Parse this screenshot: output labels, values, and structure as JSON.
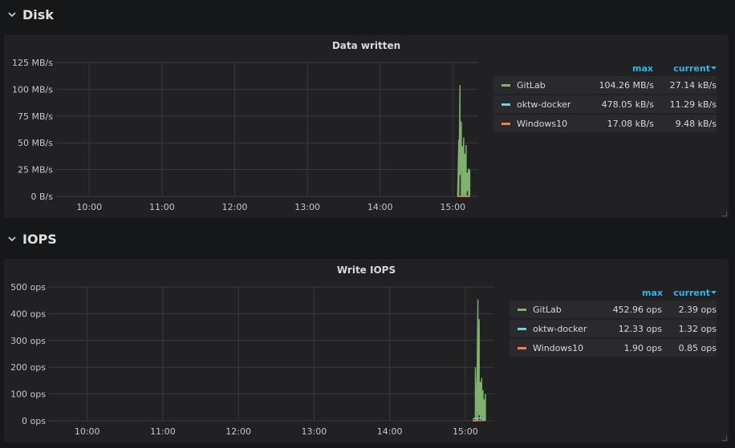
{
  "rows": [
    {
      "title": "Disk"
    },
    {
      "title": "IOPS"
    }
  ],
  "icons": {
    "row_collapse": "chevron-down-icon",
    "sort": "caret-down-icon"
  },
  "colors": {
    "GitLab": "#7eb26d",
    "oktw-docker": "#6ed0e0",
    "Windows10": "#ef843c",
    "legend_header": "#33b5e5"
  },
  "panels": [
    {
      "title": "Data written",
      "legend": {
        "header_max": "max",
        "header_current": "current",
        "items": [
          {
            "name": "GitLab",
            "max": "104.26 MB/s",
            "current": "27.14 kB/s"
          },
          {
            "name": "oktw-docker",
            "max": "478.05 kB/s",
            "current": "11.29 kB/s"
          },
          {
            "name": "Windows10",
            "max": "17.08 kB/s",
            "current": "9.48 kB/s"
          }
        ]
      }
    },
    {
      "title": "Write IOPS",
      "legend": {
        "header_max": "max",
        "header_current": "current",
        "items": [
          {
            "name": "GitLab",
            "max": "452.96 ops",
            "current": "2.39 ops"
          },
          {
            "name": "oktw-docker",
            "max": "12.33 ops",
            "current": "1.32 ops"
          },
          {
            "name": "Windows10",
            "max": "1.90 ops",
            "current": "0.85 ops"
          }
        ]
      }
    }
  ],
  "chart_data": [
    {
      "type": "line",
      "title": "Data written",
      "xlabel": "",
      "ylabel": "",
      "xlim": [
        "09:32",
        "15:21"
      ],
      "x_ticks": [
        "10:00",
        "11:00",
        "12:00",
        "13:00",
        "14:00",
        "15:00"
      ],
      "y_ticks": [
        "0 B/s",
        "25 MB/s",
        "50 MB/s",
        "75 MB/s",
        "100 MB/s",
        "125 MB/s"
      ],
      "ylim": [
        0,
        125
      ],
      "y_unit": "MB/s",
      "grid": true,
      "legend_position": "right",
      "series": [
        {
          "name": "GitLab",
          "x": [
            "15:04",
            "15:05",
            "15:05",
            "15:06",
            "15:06",
            "15:07",
            "15:07",
            "15:08",
            "15:08",
            "15:09",
            "15:09",
            "15:10",
            "15:10",
            "15:11",
            "15:11",
            "15:12",
            "15:12",
            "15:13",
            "15:13",
            "15:14",
            "15:14"
          ],
          "values": [
            0,
            53,
            0,
            104,
            20,
            70,
            0,
            47,
            0,
            55,
            0,
            40,
            0,
            48,
            0,
            22,
            5,
            26,
            0,
            25,
            0
          ]
        },
        {
          "name": "oktw-docker",
          "x": [
            "15:04",
            "15:14"
          ],
          "values": [
            0,
            0
          ]
        },
        {
          "name": "Windows10",
          "x": [
            "15:04",
            "15:14"
          ],
          "values": [
            0,
            0
          ]
        }
      ]
    },
    {
      "type": "line",
      "title": "Write IOPS",
      "xlabel": "",
      "ylabel": "",
      "xlim": [
        "09:29",
        "15:23"
      ],
      "x_ticks": [
        "10:00",
        "11:00",
        "12:00",
        "13:00",
        "14:00",
        "15:00"
      ],
      "y_ticks": [
        "0 ops",
        "100 ops",
        "200 ops",
        "300 ops",
        "400 ops",
        "500 ops"
      ],
      "ylim": [
        0,
        500
      ],
      "y_unit": "ops",
      "grid": true,
      "legend_position": "right",
      "series": [
        {
          "name": "GitLab",
          "x": [
            "15:06",
            "15:08",
            "15:08",
            "15:09",
            "15:10",
            "15:10",
            "15:11",
            "15:11",
            "15:12",
            "15:12",
            "15:13",
            "15:13",
            "15:14",
            "15:14",
            "15:15",
            "15:15",
            "15:16",
            "15:16"
          ],
          "values": [
            0,
            0,
            200,
            0,
            453,
            0,
            380,
            20,
            145,
            0,
            160,
            10,
            115,
            0,
            80,
            0,
            100,
            0
          ]
        },
        {
          "name": "oktw-docker",
          "x": [
            "15:06",
            "15:08",
            "15:10",
            "15:12",
            "15:14",
            "15:16"
          ],
          "values": [
            6,
            10,
            8,
            12,
            5,
            3
          ]
        },
        {
          "name": "Windows10",
          "x": [
            "15:06",
            "15:16"
          ],
          "values": [
            0,
            1
          ]
        }
      ]
    }
  ]
}
